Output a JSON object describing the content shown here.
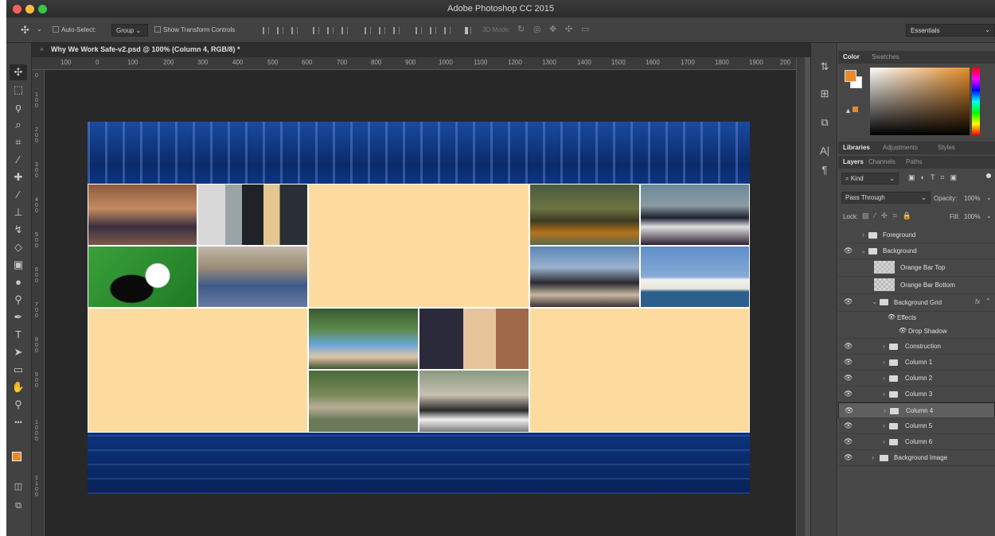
{
  "window": {
    "title": "Adobe Photoshop CC 2015"
  },
  "options": {
    "auto_select_label": "Auto-Select:",
    "auto_select_value": "Group",
    "transform_label": "Show Transform Controls",
    "mode_3d_label": "3D Mode:",
    "workspace": "Essentials"
  },
  "document": {
    "tab_title": "Why We Work Safe-v2.psd @ 100% (Column 4, RGB/8) *",
    "ruler_h": [
      "100",
      "0",
      "100",
      "200",
      "300",
      "400",
      "500",
      "600",
      "700",
      "800",
      "900",
      "1000",
      "1100",
      "1200",
      "1300",
      "1400",
      "1500",
      "1600",
      "1700",
      "1800",
      "1900",
      "200"
    ],
    "ruler_v": [
      "0",
      "100",
      "200",
      "300",
      "400",
      "500",
      "600",
      "700",
      "800",
      "900",
      "1000",
      "1100"
    ]
  },
  "tools": [
    {
      "icon": "move-icon",
      "glyph": "✣"
    },
    {
      "icon": "marquee-icon",
      "glyph": "⬚"
    },
    {
      "icon": "lasso-icon",
      "glyph": "ϙ"
    },
    {
      "icon": "quick-select-icon",
      "glyph": "⌕"
    },
    {
      "icon": "crop-icon",
      "glyph": "⌗"
    },
    {
      "icon": "eyedropper-icon",
      "glyph": "⁄"
    },
    {
      "icon": "healing-brush-icon",
      "glyph": "✚"
    },
    {
      "icon": "brush-icon",
      "glyph": "∕"
    },
    {
      "icon": "stamp-icon",
      "glyph": "⊥"
    },
    {
      "icon": "history-brush-icon",
      "glyph": "↯"
    },
    {
      "icon": "eraser-icon",
      "glyph": "◇"
    },
    {
      "icon": "gradient-icon",
      "glyph": "▣"
    },
    {
      "icon": "blur-icon",
      "glyph": "●"
    },
    {
      "icon": "dodge-icon",
      "glyph": "⚲"
    },
    {
      "icon": "pen-icon",
      "glyph": "✒"
    },
    {
      "icon": "type-icon",
      "glyph": "T"
    },
    {
      "icon": "path-select-icon",
      "glyph": "➤"
    },
    {
      "icon": "rectangle-icon",
      "glyph": "▭"
    },
    {
      "icon": "hand-icon",
      "glyph": "✋"
    },
    {
      "icon": "zoom-icon",
      "glyph": "⚲"
    },
    {
      "icon": "more-tools-icon",
      "glyph": "•••"
    }
  ],
  "colors": {
    "foreground": "#e8892a",
    "background": "#ffffff",
    "tan": "#fddb9f",
    "selected_row": "#5f5f5f"
  },
  "color_panel": {
    "tabs": [
      "Color",
      "Swatches"
    ]
  },
  "libraries_panel": {
    "tabs": [
      "Libraries",
      "Adjustments",
      "Styles"
    ]
  },
  "layers_panel": {
    "tabs": [
      "Layers",
      "Channels",
      "Paths"
    ],
    "filter_kind": "Kind",
    "blend_mode": "Pass Through",
    "opacity_label": "Opacity:",
    "opacity_value": "100%",
    "lock_label": "Lock:",
    "fill_label": "Fill:",
    "fill_value": "100%",
    "fx_label": "fx",
    "layers": [
      {
        "name": "Foreground",
        "kind": "group",
        "visible": false,
        "expanded": false,
        "indent": 0
      },
      {
        "name": "Background",
        "kind": "group",
        "visible": true,
        "expanded": true,
        "indent": 0
      },
      {
        "name": "Orange Bar Top",
        "kind": "layer",
        "visible": false,
        "indent": 1
      },
      {
        "name": "Orange Bar Bottom",
        "kind": "layer",
        "visible": false,
        "indent": 1
      },
      {
        "name": "Background Grid",
        "kind": "group",
        "visible": true,
        "expanded": true,
        "indent": 1,
        "fx": true
      },
      {
        "name": "Effects",
        "kind": "effect",
        "visible": true,
        "indent": 2
      },
      {
        "name": "Drop Shadow",
        "kind": "effect",
        "visible": true,
        "indent": 3
      },
      {
        "name": "Construction",
        "kind": "group",
        "visible": true,
        "expanded": false,
        "indent": 2
      },
      {
        "name": "Column 1",
        "kind": "group",
        "visible": true,
        "expanded": false,
        "indent": 2
      },
      {
        "name": "Column 2",
        "kind": "group",
        "visible": true,
        "expanded": false,
        "indent": 2
      },
      {
        "name": "Column 3",
        "kind": "group",
        "visible": true,
        "expanded": false,
        "indent": 2
      },
      {
        "name": "Column 4",
        "kind": "group",
        "visible": true,
        "expanded": false,
        "indent": 2,
        "selected": true
      },
      {
        "name": "Column 5",
        "kind": "group",
        "visible": true,
        "expanded": false,
        "indent": 2
      },
      {
        "name": "Column 6",
        "kind": "group",
        "visible": true,
        "expanded": false,
        "indent": 2
      },
      {
        "name": "Background Image",
        "kind": "group",
        "visible": true,
        "expanded": false,
        "indent": 1
      }
    ]
  }
}
